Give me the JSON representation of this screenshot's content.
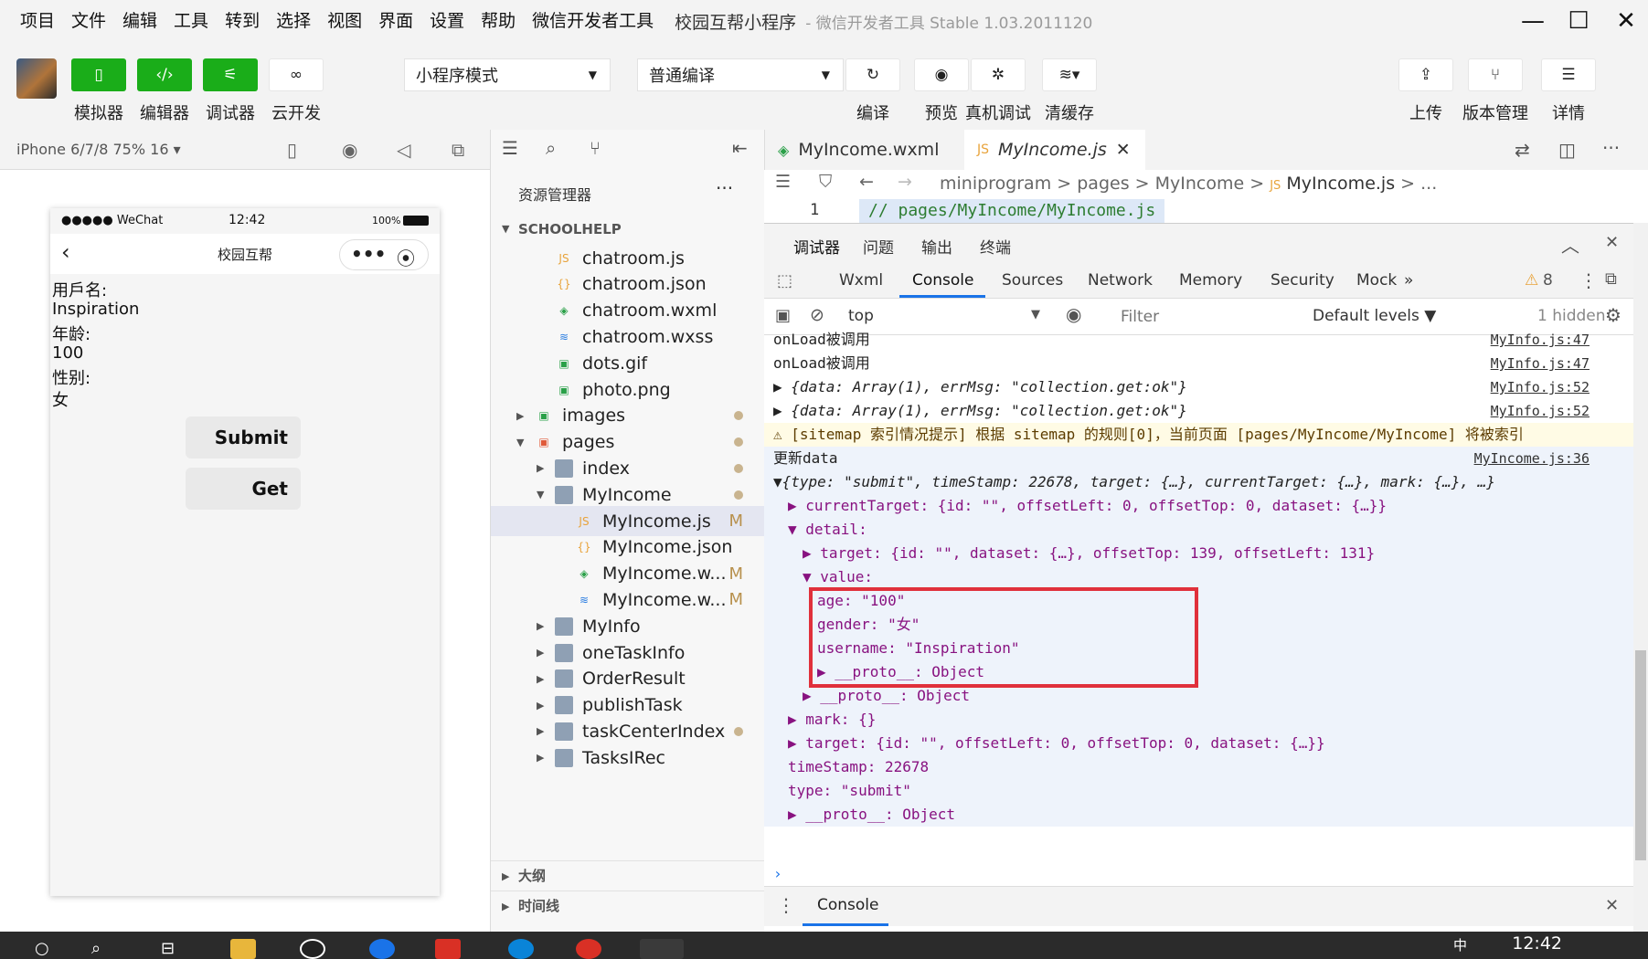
{
  "menubar": {
    "items": [
      "项目",
      "文件",
      "编辑",
      "工具",
      "转到",
      "选择",
      "视图",
      "界面",
      "设置",
      "帮助",
      "微信开发者工具"
    ],
    "app_title": "校园互帮小程序",
    "app_subtitle": "- 微信开发者工具 Stable 1.03.2011120"
  },
  "toolbar": {
    "left_buttons": [
      {
        "label": "模拟器",
        "icon": "phone-icon"
      },
      {
        "label": "编辑器",
        "icon": "code-icon"
      },
      {
        "label": "调试器",
        "icon": "debug-sliders-icon"
      },
      {
        "label": "云开发",
        "icon": "cloud-link-icon"
      }
    ],
    "mode_select": "小程序模式",
    "compile_select": "普通编译",
    "mid_buttons": [
      {
        "label": "编译",
        "icon": "refresh-icon"
      },
      {
        "label": "预览",
        "icon": "eye-icon"
      },
      {
        "label": "真机调试",
        "icon": "bug-icon"
      },
      {
        "label": "清缓存",
        "icon": "layers-icon"
      }
    ],
    "right_buttons": [
      {
        "label": "上传",
        "icon": "upload-icon"
      },
      {
        "label": "版本管理",
        "icon": "branch-icon"
      },
      {
        "label": "详情",
        "icon": "menu-icon"
      }
    ]
  },
  "simulator": {
    "device": "iPhone 6/7/8 75% 16 ▾",
    "status_left": "●●●●● WeChat",
    "status_time": "12:42",
    "status_battery": "100%",
    "nav_title": "校园互帮",
    "labels": [
      "用戶名:",
      "Inspiration",
      "年龄:",
      "100",
      "性别:",
      "女"
    ],
    "submit_label": "Submit",
    "get_label": "Get"
  },
  "explorer": {
    "title": "资源管理器",
    "more": "···",
    "section": "SCHOOLHELP",
    "files": [
      {
        "name": "chatroom.js",
        "type": "js",
        "depth": 2
      },
      {
        "name": "chatroom.json",
        "type": "json",
        "depth": 2
      },
      {
        "name": "chatroom.wxml",
        "type": "wxml",
        "depth": 2
      },
      {
        "name": "chatroom.wxss",
        "type": "wxss",
        "depth": 2
      },
      {
        "name": "dots.gif",
        "type": "img",
        "depth": 2
      },
      {
        "name": "photo.png",
        "type": "img",
        "depth": 2
      },
      {
        "name": "images",
        "type": "folder-img",
        "depth": 1,
        "arrow": "▶",
        "dot": true
      },
      {
        "name": "pages",
        "type": "folder-red",
        "depth": 1,
        "arrow": "▼",
        "dot": true
      },
      {
        "name": "index",
        "type": "folder",
        "depth": 2,
        "arrow": "▶",
        "dot": true
      },
      {
        "name": "MyIncome",
        "type": "folder-open",
        "depth": 2,
        "arrow": "▼",
        "dot": true
      },
      {
        "name": "MyIncome.js",
        "type": "js",
        "depth": 3,
        "mark": "M",
        "selected": true
      },
      {
        "name": "MyIncome.json",
        "type": "json",
        "depth": 3
      },
      {
        "name": "MyIncome.w...",
        "type": "wxml",
        "depth": 3,
        "mark": "M"
      },
      {
        "name": "MyIncome.w...",
        "type": "wxss",
        "depth": 3,
        "mark": "M"
      },
      {
        "name": "MyInfo",
        "type": "folder",
        "depth": 2,
        "arrow": "▶"
      },
      {
        "name": "oneTaskInfo",
        "type": "folder",
        "depth": 2,
        "arrow": "▶"
      },
      {
        "name": "OrderResult",
        "type": "folder",
        "depth": 2,
        "arrow": "▶"
      },
      {
        "name": "publishTask",
        "type": "folder",
        "depth": 2,
        "arrow": "▶"
      },
      {
        "name": "taskCenterIndex",
        "type": "folder",
        "depth": 2,
        "arrow": "▶",
        "dot": true
      },
      {
        "name": "TasksIRec",
        "type": "folder",
        "depth": 2,
        "arrow": "▶"
      }
    ],
    "outline": "大纲",
    "timeline": "时间线"
  },
  "editor": {
    "tabs": [
      {
        "name": "MyIncome.wxml",
        "icon": "wxml-file-icon"
      },
      {
        "name": "MyIncome.js",
        "icon": "js-file-icon",
        "active": true
      }
    ],
    "breadcrumb": [
      "miniprogram",
      ">",
      "pages",
      ">",
      "MyIncome",
      ">",
      "MyIncome.js",
      ">",
      "..."
    ],
    "line_no": "1",
    "code": "// pages/MyIncome/MyIncome.js"
  },
  "devtools": {
    "top_tabs": [
      "调试器",
      "问题",
      "输出",
      "终端"
    ],
    "tabs": [
      "Wxml",
      "Console",
      "Sources",
      "Network",
      "Memory",
      "Security",
      "Mock",
      "»"
    ],
    "active_tab": "Console",
    "warn_count": "8",
    "context": "top",
    "filter_placeholder": "Filter",
    "levels": "Default levels ▼",
    "hidden": "1 hidden",
    "bottom_tab": "Console",
    "colors": {
      "accent": "#1a73e8",
      "highlight_box": "#e0303b",
      "warn_bg": "#fffbe5"
    }
  },
  "console_lines": [
    {
      "text": "onLoad被调用",
      "src": "MyInfo.js:47",
      "indent": 0
    },
    {
      "text": "onLoad被调用",
      "src": "MyInfo.js:47",
      "indent": 0
    },
    {
      "text": "▶ {data: Array(1), errMsg: \"collection.get:ok\"}",
      "src": "MyInfo.js:52",
      "indent": 0
    },
    {
      "text": "▶ {data: Array(1), errMsg: \"collection.get:ok\"}",
      "src": "MyInfo.js:52",
      "indent": 0
    },
    {
      "text": "⚠ [sitemap 索引情况提示] 根据 sitemap 的规则[0]，当前页面 [pages/MyIncome/MyIncome] 将被索引",
      "src": "",
      "indent": 0,
      "warn": true
    },
    {
      "text": "更新data",
      "src": "MyIncome.js:36",
      "indent": 0,
      "group": true
    },
    {
      "text": "▼{type: \"submit\", timeStamp: 22678, target: {…}, currentTarget: {…}, mark: {…}, …}",
      "src": "",
      "indent": 0,
      "group": true
    },
    {
      "text": "▶ currentTarget: {id: \"\", offsetLeft: 0, offsetTop: 0, dataset: {…}}",
      "src": "",
      "indent": 1,
      "group": true
    },
    {
      "text": "▼ detail:",
      "src": "",
      "indent": 1,
      "group": true
    },
    {
      "text": "▶ target: {id: \"\", dataset: {…}, offsetTop: 139, offsetLeft: 131}",
      "src": "",
      "indent": 2,
      "group": true
    },
    {
      "text": "▼ value:",
      "src": "",
      "indent": 2,
      "group": true
    },
    {
      "text": "age: \"100\"",
      "src": "",
      "indent": 3,
      "group": true
    },
    {
      "text": "gender: \"女\"",
      "src": "",
      "indent": 3,
      "group": true
    },
    {
      "text": "username: \"Inspiration\"",
      "src": "",
      "indent": 3,
      "group": true
    },
    {
      "text": "▶ __proto__: Object",
      "src": "",
      "indent": 3,
      "group": true
    },
    {
      "text": "▶ __proto__: Object",
      "src": "",
      "indent": 2,
      "group": true
    },
    {
      "text": "▶ mark: {}",
      "src": "",
      "indent": 1,
      "group": true
    },
    {
      "text": "▶ target: {id: \"\", offsetLeft: 0, offsetTop: 0, dataset: {…}}",
      "src": "",
      "indent": 1,
      "group": true
    },
    {
      "text": "timeStamp: 22678",
      "src": "",
      "indent": 1,
      "group": true
    },
    {
      "text": "type: \"submit\"",
      "src": "",
      "indent": 1,
      "group": true
    },
    {
      "text": "▶ __proto__: Object",
      "src": "",
      "indent": 1,
      "group": true
    }
  ],
  "taskbar": {
    "time": "12:42",
    "ime": "中"
  }
}
